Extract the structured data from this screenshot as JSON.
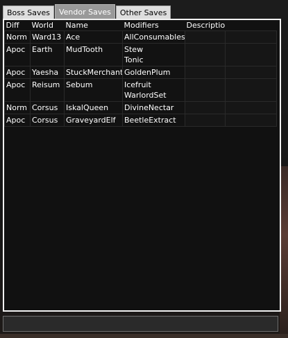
{
  "tabs": [
    {
      "label": "Boss Saves",
      "active": false
    },
    {
      "label": "Vendor Saves",
      "active": true
    },
    {
      "label": "Other Saves",
      "active": false
    }
  ],
  "table": {
    "headers": [
      "Diff",
      "World",
      "Name",
      "Modifiers",
      "Description",
      ""
    ],
    "rows": [
      {
        "diff": "Norm",
        "world": "Ward13",
        "name": "Ace",
        "modifiers": [
          "AllConsumables"
        ],
        "description": ""
      },
      {
        "diff": "Apoc",
        "world": "Earth",
        "name": "MudTooth",
        "modifiers": [
          "Stew",
          "Tonic"
        ],
        "description": ""
      },
      {
        "diff": "Apoc",
        "world": "Yaesha",
        "name": "StuckMerchant",
        "modifiers": [
          "GoldenPlum"
        ],
        "description": ""
      },
      {
        "diff": "Apoc",
        "world": "Reisum",
        "name": "Sebum",
        "modifiers": [
          "Icefruit",
          "WarlordSet"
        ],
        "description": ""
      },
      {
        "diff": "Norm",
        "world": "Corsus",
        "name": "IskalQueen",
        "modifiers": [
          "DivineNectar"
        ],
        "description": ""
      },
      {
        "diff": "Apoc",
        "world": "Corsus",
        "name": "GraveyardElf",
        "modifiers": [
          "BeetleExtract"
        ],
        "description": ""
      }
    ]
  },
  "footer": {
    "value": ""
  }
}
